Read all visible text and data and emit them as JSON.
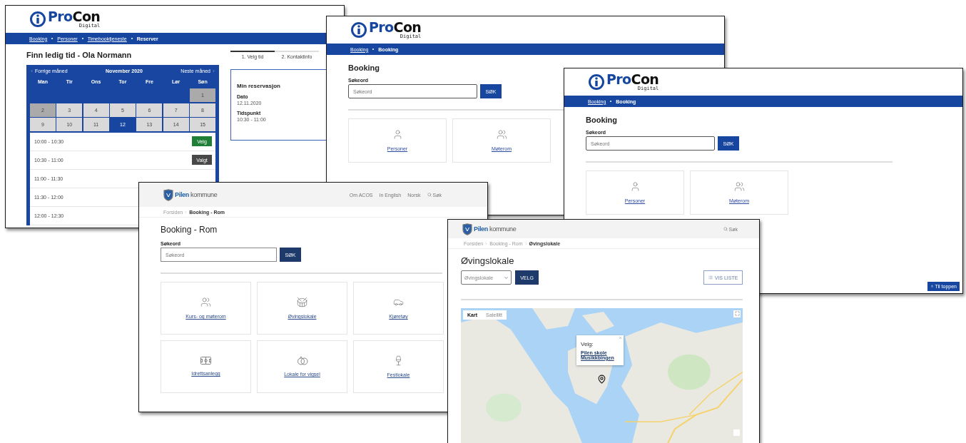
{
  "windows": [
    {
      "kind": "calendar",
      "logo": {
        "name_parts": [
          "Pro",
          "Con"
        ],
        "subtitle": "Digital"
      },
      "breadcrumb": [
        {
          "label": "Booking",
          "link": true
        },
        {
          "label": "Personer",
          "link": true
        },
        {
          "label": "Timebooktjeneste",
          "link": true
        },
        {
          "label": "Reserver",
          "link": false
        }
      ],
      "title": "Finn ledig tid - Ola Normann",
      "calendar": {
        "previous": "Forrige måned",
        "month": "November 2020",
        "next": "Neste måned",
        "weekdays": [
          "Man",
          "Tir",
          "Ons",
          "Tor",
          "Fre",
          "Lør",
          "Søn"
        ],
        "weeks": [
          [
            {
              "day": "1",
              "disabled": true,
              "selected": false
            }
          ],
          [
            {
              "day": "2",
              "disabled": true,
              "selected": false
            },
            {
              "day": "3",
              "disabled": false,
              "selected": false
            },
            {
              "day": "4",
              "disabled": false,
              "selected": false
            },
            {
              "day": "5",
              "disabled": false,
              "selected": false
            },
            {
              "day": "6",
              "disabled": false,
              "selected": false
            },
            {
              "day": "7",
              "disabled": false,
              "selected": false
            },
            {
              "day": "8",
              "disabled": false,
              "selected": false
            }
          ],
          [
            {
              "day": "9",
              "disabled": false,
              "selected": false
            },
            {
              "day": "10",
              "disabled": false,
              "selected": false
            },
            {
              "day": "11",
              "disabled": false,
              "selected": false
            },
            {
              "day": "12",
              "disabled": false,
              "selected": true
            },
            {
              "day": "13",
              "disabled": false,
              "selected": false
            },
            {
              "day": "14",
              "disabled": false,
              "selected": false
            },
            {
              "day": "15",
              "disabled": false,
              "selected": false
            }
          ]
        ]
      },
      "slots": [
        {
          "time": "10:00 - 10:30",
          "button": {
            "label": "Velg",
            "selected": false
          }
        },
        {
          "time": "10:30 - 11:00",
          "button": {
            "label": "Valgt",
            "selected": true
          }
        },
        {
          "time": "11:00 - 11:30"
        },
        {
          "time": "11:30 - 12:00"
        },
        {
          "time": "12:00 - 12:30"
        }
      ],
      "steps": [
        {
          "label": "1. Velg tid",
          "selected": true
        },
        {
          "label": "2. Kontaktinfo",
          "selected": false
        }
      ],
      "reservation": {
        "title": "Min reservasjon",
        "fields": [
          {
            "label": "Dato",
            "value": "12.11.2020"
          },
          {
            "label": "Tidspunkt",
            "value": "10:30 - 11:00"
          }
        ]
      }
    },
    {
      "kind": "procon-search",
      "logo": {
        "name_parts": [
          "Pro",
          "Con"
        ],
        "subtitle": "Digital"
      },
      "breadcrumb": [
        {
          "label": "Booking",
          "link": true
        },
        {
          "label": "Booking",
          "link": false
        }
      ],
      "title": "Booking",
      "search": {
        "label": "Søkeord",
        "placeholder": "Søkeord",
        "button": "SØK"
      },
      "cards": [
        "Personer",
        "Møterom"
      ]
    },
    {
      "kind": "procon-search",
      "logo": {
        "name_parts": [
          "Pro",
          "Con"
        ],
        "subtitle": "Digital"
      },
      "breadcrumb": [
        {
          "label": "Booking",
          "link": true
        },
        {
          "label": "Booking",
          "link": false
        }
      ],
      "title": "Booking",
      "search": {
        "label": "Søkeord",
        "placeholder": "Søkeord",
        "button": "SØK"
      },
      "cards": [
        "Personer",
        "Møterom"
      ],
      "back_to_top": "Til toppen"
    },
    {
      "kind": "pilen-search",
      "logo": {
        "name": "Pilen",
        "subtitle": "kommune"
      },
      "nav": [
        "Om ACOS",
        "In English",
        "Norsk"
      ],
      "search_link": "Søk",
      "breadcrumb": [
        {
          "label": "Forsiden",
          "current": false
        },
        {
          "label": "Booking - Rom",
          "current": true
        }
      ],
      "title": "Booking - Rom",
      "search": {
        "label": "Søkeord",
        "placeholder": "Søkeord",
        "button": "SØK"
      },
      "cards": [
        "Kurs- og møterom",
        "Øvingslokale",
        "Kjøretøy",
        "Idrettsanlegg",
        "Lokale for vigsel",
        "Festlokale"
      ]
    },
    {
      "kind": "pilen-map",
      "logo": {
        "name": "Pilen",
        "subtitle": "kommune"
      },
      "search_link": "Søk",
      "breadcrumb": [
        {
          "label": "Forsiden",
          "current": false
        },
        {
          "label": "Booking - Rom",
          "current": false
        },
        {
          "label": "Øvingslokale",
          "current": true
        }
      ],
      "title": "Øvingslokale",
      "select": {
        "placeholder": "Øvingslokale"
      },
      "button": "VELG",
      "list_button": "VIS LISTE",
      "map": {
        "tabs": [
          {
            "label": "Kart",
            "selected": true
          },
          {
            "label": "Satellitt",
            "selected": false
          }
        ],
        "popup": {
          "title": "Velg:",
          "links": [
            "Pilen skole",
            "Musikkbingen"
          ]
        }
      }
    }
  ]
}
